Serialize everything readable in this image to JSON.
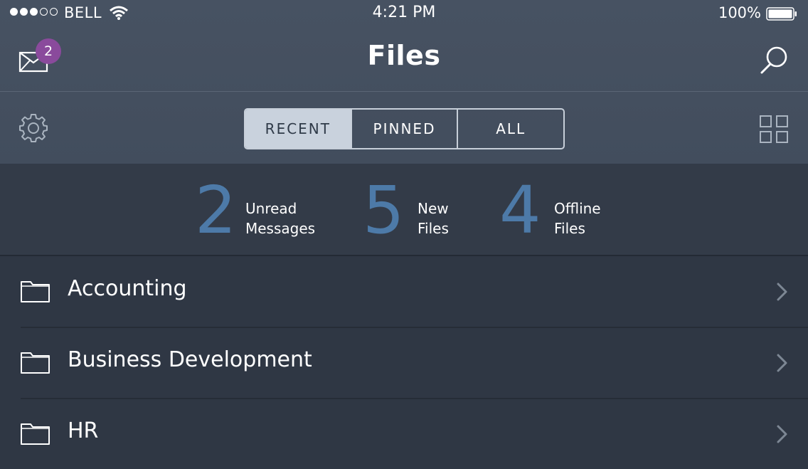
{
  "status_bar": {
    "carrier": "BELL",
    "time": "4:21 PM",
    "battery_percent": "100%",
    "signal_bars_filled": 3,
    "signal_bars_total": 5
  },
  "nav_bar": {
    "title": "Files",
    "messages_badge": "2",
    "left_icon": "mail-icon",
    "right_icon": "search-icon"
  },
  "toolbar": {
    "left_icon": "gear-icon",
    "right_icon": "grid-view-icon",
    "segments": [
      {
        "label": "RECENT",
        "active": true
      },
      {
        "label": "PINNED",
        "active": false
      },
      {
        "label": "ALL",
        "active": false
      }
    ]
  },
  "stats": [
    {
      "value": "2",
      "label_line1": "Unread",
      "label_line2": "Messages"
    },
    {
      "value": "5",
      "label_line1": "New",
      "label_line2": "Files"
    },
    {
      "value": "4",
      "label_line1": "Offline",
      "label_line2": "Files"
    }
  ],
  "folders": [
    {
      "name": "Accounting",
      "icon": "folder-icon"
    },
    {
      "name": "Business Development",
      "icon": "folder-icon"
    },
    {
      "name": "HR",
      "icon": "folder-icon"
    }
  ],
  "colors": {
    "header_bg": "#475262",
    "list_bg": "#2f3744",
    "stat_number": "#4d7aa8",
    "badge": "#8a4a9c",
    "segment_active_bg": "#c9d2dd"
  }
}
